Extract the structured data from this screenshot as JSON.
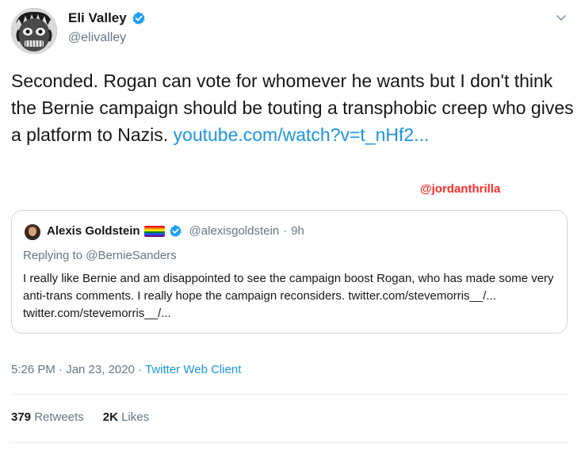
{
  "author": {
    "name": "Eli Valley",
    "handle": "@elivalley"
  },
  "tweet": {
    "text": "Seconded. Rogan can vote for whomever he wants but I don't think the Bernie campaign should be touting a transphobic creep who gives a platform to Nazis.",
    "link": "youtube.com/watch?v=t_nHf2..."
  },
  "watermark": "@jordanthrilla",
  "quote": {
    "name": "Alexis Goldstein",
    "handle": "@alexisgoldstein",
    "separator": "·",
    "time": "9h",
    "reply_to": "Replying to @BernieSanders",
    "text": "I really like Bernie and am disappointed to see the campaign boost Rogan, who has made some very anti-trans comments. I really hope the campaign reconsiders. twitter.com/stevemorris__/... twitter.com/stevemorris__/..."
  },
  "footer": {
    "time": "5:26 PM · Jan 23, 2020 · ",
    "client": "Twitter Web Client",
    "retweets_count": "379",
    "retweets_label": "Retweets",
    "likes_count": "2K",
    "likes_label": "Likes"
  },
  "colors": {
    "link": "#1b95e0",
    "muted": "#657786",
    "border": "#ccd6dd",
    "watermark": "#ff2a2a",
    "verified": "#1da1f2"
  },
  "icons": {
    "verified": "verified-badge-icon",
    "caret": "chevron-down-icon",
    "flag": "rainbow-flag-icon"
  }
}
